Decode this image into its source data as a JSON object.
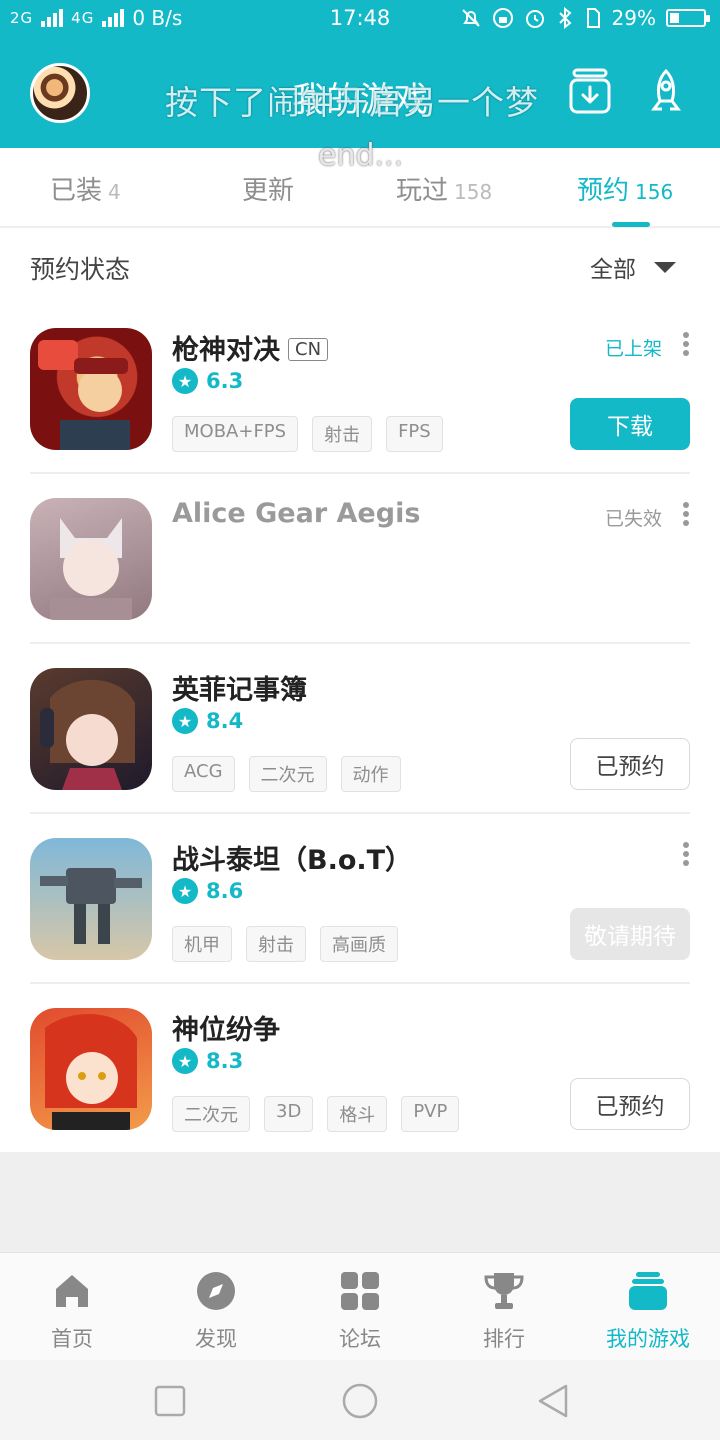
{
  "status_bar": {
    "signal_1": "2G",
    "signal_2": "4G",
    "net_speed": "0 B/s",
    "time": "17:48",
    "battery": "29%",
    "battery_level": 0.29
  },
  "header": {
    "title": "我的游戏",
    "overlay_line1": "按下了闹钟开启另一个梦",
    "overlay_line2": "end..."
  },
  "tabs": [
    {
      "label": "已装",
      "count": "4"
    },
    {
      "label": "更新",
      "count": ""
    },
    {
      "label": "玩过",
      "count": "158"
    },
    {
      "label": "预约",
      "count": "156",
      "active": true
    }
  ],
  "filter": {
    "title": "预约状态",
    "selected": "全部"
  },
  "games": [
    {
      "name": "枪神对决",
      "region": "CN",
      "rating": "6.3",
      "tags": [
        "MOBA+FPS",
        "射击",
        "FPS"
      ],
      "status": "已上架",
      "button": "下载"
    },
    {
      "name": "Alice Gear Aegis",
      "status": "已失效"
    },
    {
      "name": "英菲记事簿",
      "rating": "8.4",
      "tags": [
        "ACG",
        "二次元",
        "动作"
      ],
      "button": "已预约"
    },
    {
      "name": "战斗泰坦（B.o.T）",
      "rating": "8.6",
      "tags": [
        "机甲",
        "射击",
        "高画质"
      ],
      "button": "敬请期待"
    },
    {
      "name": "神位纷争",
      "rating": "8.3",
      "tags": [
        "二次元",
        "3D",
        "格斗",
        "PVP"
      ],
      "button": "已预约"
    }
  ],
  "bottom_nav": [
    {
      "label": "首页",
      "icon": "home-icon"
    },
    {
      "label": "发现",
      "icon": "compass-icon"
    },
    {
      "label": "论坛",
      "icon": "grid-icon"
    },
    {
      "label": "排行",
      "icon": "trophy-icon"
    },
    {
      "label": "我的游戏",
      "icon": "my-games-icon",
      "active": true
    }
  ],
  "colors": {
    "accent": "#14b9c8",
    "text": "#333333",
    "muted": "#8e8e8e"
  }
}
